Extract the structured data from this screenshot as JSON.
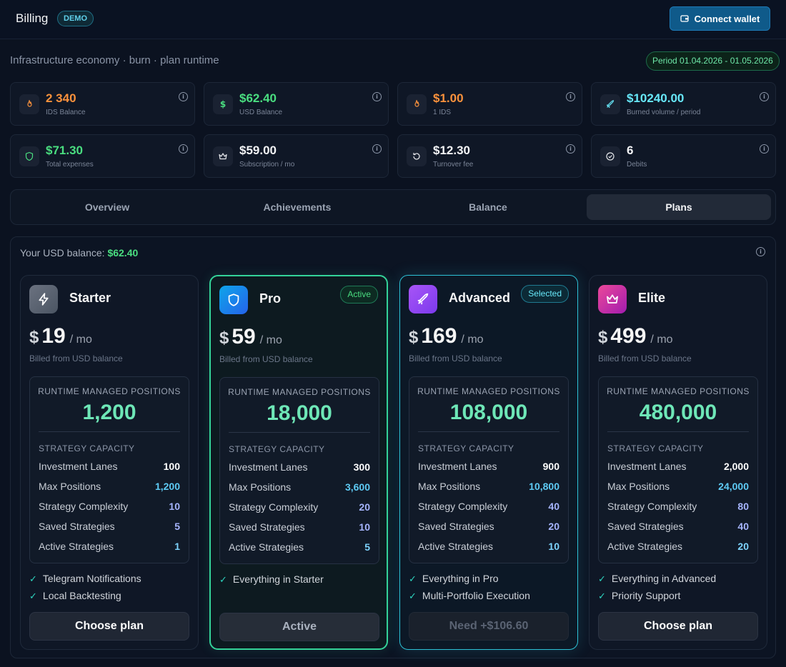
{
  "header": {
    "title": "Billing",
    "badge": "DEMO",
    "connect_label": "Connect wallet"
  },
  "subtitle": "Infrastructure economy · burn · plan runtime",
  "period": "Period 01.04.2026 - 01.05.2026",
  "info_glyph": "i",
  "stats": [
    {
      "value": "2 340",
      "label": "IDS Balance",
      "icon": "flame-icon",
      "color": "#fb923c"
    },
    {
      "value": "$62.40",
      "label": "USD Balance",
      "icon": "dollar-icon",
      "color": "#4ade80"
    },
    {
      "value": "$1.00",
      "label": "1 IDS",
      "icon": "flame-icon",
      "color": "#fb923c"
    },
    {
      "value": "$10240.00",
      "label": "Burned volume / period",
      "icon": "rocket-icon",
      "color": "#67e8f9"
    },
    {
      "value": "$71.30",
      "label": "Total expenses",
      "icon": "shield-icon",
      "color": "#4ade80"
    },
    {
      "value": "$59.00",
      "label": "Subscription / mo",
      "icon": "crown-icon",
      "color": "#f3f4f6"
    },
    {
      "value": "$12.30",
      "label": "Turnover fee",
      "icon": "refresh-icon",
      "color": "#f3f4f6"
    },
    {
      "value": "6",
      "label": "Debits",
      "icon": "check-circle-icon",
      "color": "#f3f4f6"
    }
  ],
  "tabs": [
    "Overview",
    "Achievements",
    "Balance",
    "Plans"
  ],
  "active_tab": "Plans",
  "balance_label": "Your USD balance:",
  "balance_value": "$62.40",
  "plan_common": {
    "currency": "$",
    "per": "/ mo",
    "billed": "Billed from USD balance",
    "rmp_title": "RUNTIME MANAGED POSITIONS",
    "capacity_title": "STRATEGY CAPACITY",
    "row_labels": [
      "Investment Lanes",
      "Max Positions",
      "Strategy Complexity",
      "Saved Strategies",
      "Active Strategies"
    ],
    "check_glyph": "✓"
  },
  "plans": [
    {
      "name": "Starter",
      "price": "19",
      "badge": "",
      "rmp": "1,200",
      "values": [
        "100",
        "1,200",
        "10",
        "5",
        "1"
      ],
      "features": [
        "Telegram Notifications",
        "Local Backtesting"
      ],
      "button": "Choose plan",
      "icon": "bolt-icon"
    },
    {
      "name": "Pro",
      "price": "59",
      "badge": "Active",
      "rmp": "18,000",
      "values": [
        "300",
        "3,600",
        "20",
        "10",
        "5"
      ],
      "features": [
        "Everything in Starter"
      ],
      "button": "Active",
      "icon": "shield-icon"
    },
    {
      "name": "Advanced",
      "price": "169",
      "badge": "Selected",
      "rmp": "108,000",
      "values": [
        "900",
        "10,800",
        "40",
        "20",
        "10"
      ],
      "features": [
        "Everything in Pro",
        "Multi-Portfolio Execution"
      ],
      "button": "Need +$106.60",
      "icon": "rocket-icon"
    },
    {
      "name": "Elite",
      "price": "499",
      "badge": "",
      "rmp": "480,000",
      "values": [
        "2,000",
        "24,000",
        "80",
        "40",
        "20"
      ],
      "features": [
        "Everything in Advanced",
        "Priority Support"
      ],
      "button": "Choose plan",
      "icon": "crown-icon"
    }
  ],
  "colors": {
    "accent_green": "#4ade80",
    "accent_cyan": "#67e8f9",
    "value_white": "#ffffff",
    "value_cyan": "#5ecbf5",
    "value_violet": "#a5b4fc",
    "value_sky": "#7dd3fc"
  }
}
